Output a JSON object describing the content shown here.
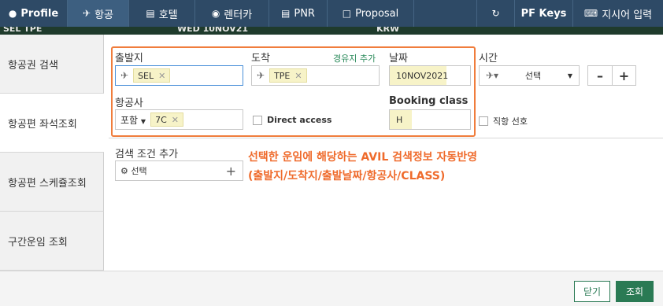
{
  "nav": {
    "profile": "Profile",
    "airline": "항공",
    "hotel": "호텔",
    "rentacar": "렌터카",
    "pnr": "PNR",
    "proposal": "Proposal",
    "pfkeys": "PF Keys",
    "command": "지시어 입력"
  },
  "subbar": {
    "route": "SEL  TPE",
    "date": "WED  10NOV21",
    "currency": "KRW"
  },
  "sidebar": {
    "tabs": [
      {
        "label": "항공권 검색"
      },
      {
        "label": "항공편 좌석조회"
      },
      {
        "label": "항공편 스케쥴조회"
      },
      {
        "label": "구간운임 조회"
      }
    ]
  },
  "form": {
    "origin_label": "출발지",
    "origin_value": "SEL",
    "dest_label": "도착",
    "add_via": "경유지 추가",
    "dest_value": "TPE",
    "date_label": "날짜",
    "date_value": "10NOV2021",
    "time_label": "시간",
    "time_select": "선택",
    "airline_label": "항공사",
    "airline_mode": "포함",
    "airline_value": "7C",
    "direct_access": "Direct access",
    "booking_class_label": "Booking class",
    "booking_class_value": "H",
    "direct_flight": "직항 선호",
    "more_label": "검색 조건 추가",
    "more_select": "선택"
  },
  "annotation": {
    "line1": "선택한 운임에 해당하는 AVIL 검색정보 자동반영",
    "line2": "(출발지/도착지/출발날짜/항공사/CLASS)"
  },
  "footer": {
    "close": "닫기",
    "search": "조회"
  },
  "colors": {
    "nav_bg": "#2e4a66",
    "highlight": "#f07d3c",
    "primary": "#2a7a54",
    "chip_bg": "#f7f3c8"
  }
}
